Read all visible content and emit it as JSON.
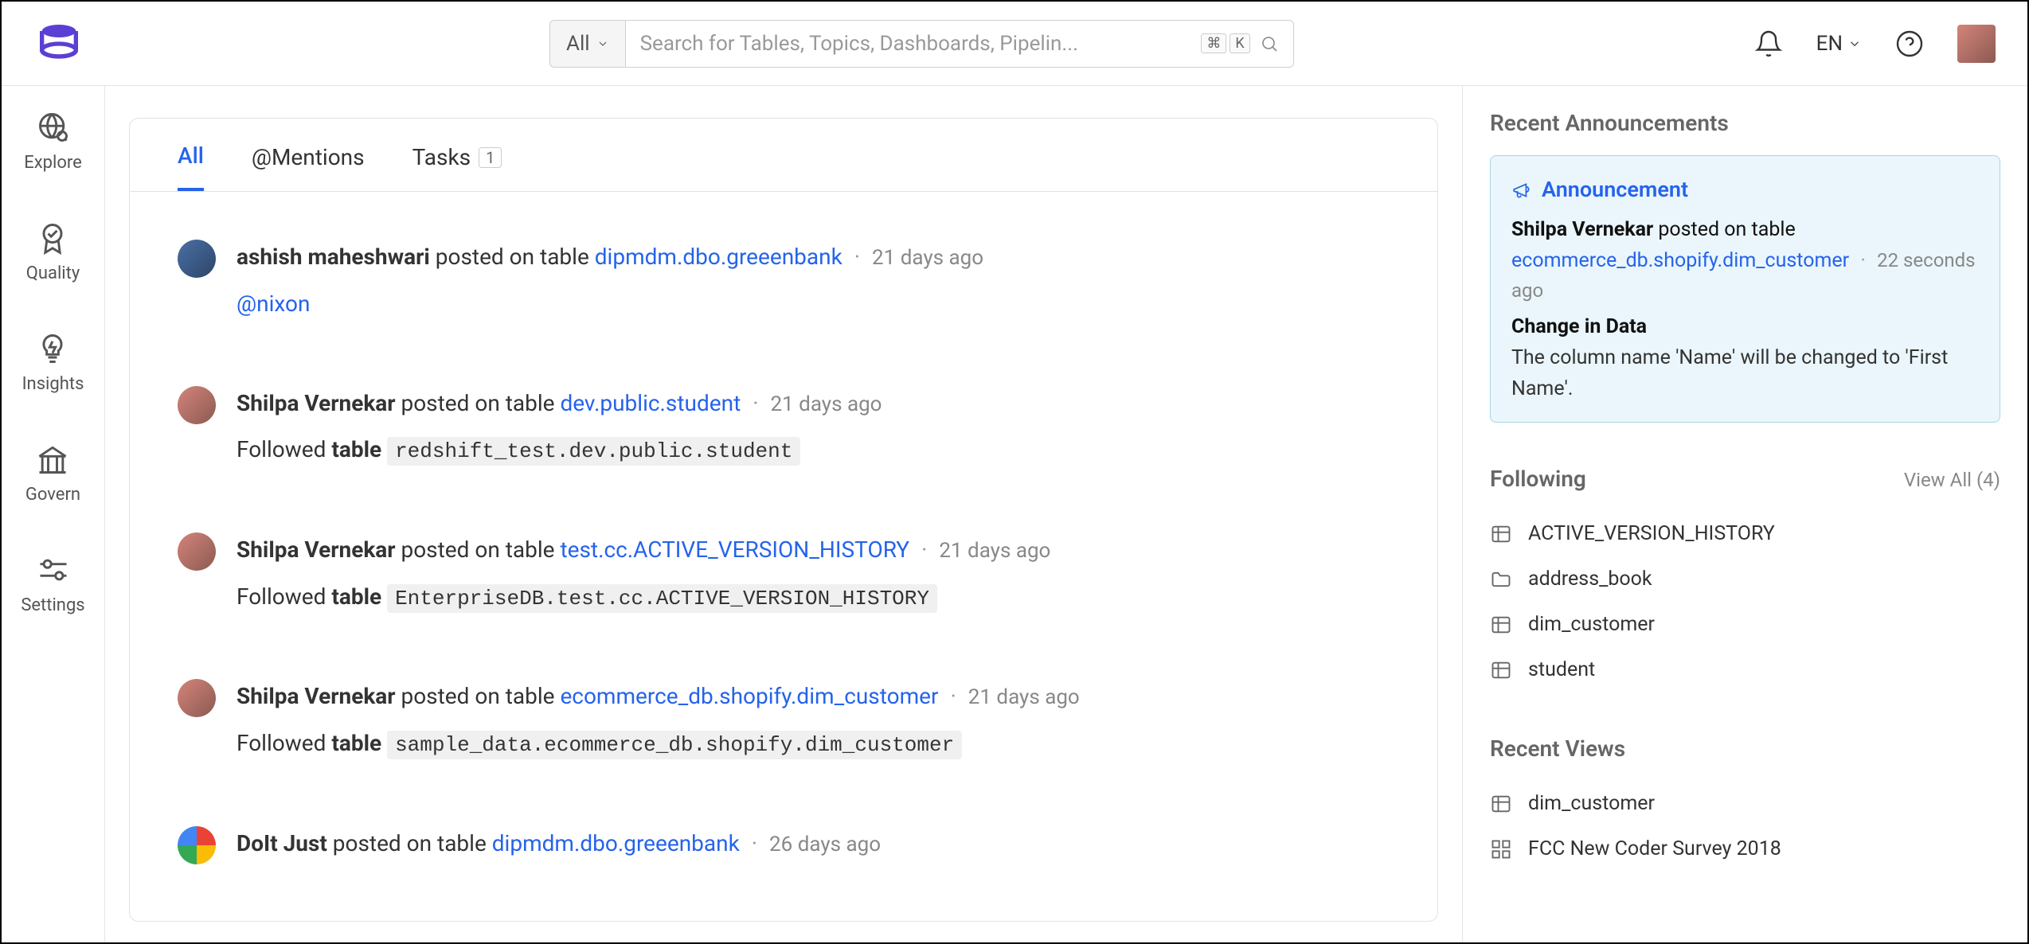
{
  "header": {
    "filter_label": "All",
    "search_placeholder": "Search for Tables, Topics, Dashboards, Pipelin...",
    "kbd1": "⌘",
    "kbd2": "K",
    "language": "EN"
  },
  "sidebar": {
    "items": [
      {
        "label": "Explore"
      },
      {
        "label": "Quality"
      },
      {
        "label": "Insights"
      },
      {
        "label": "Govern"
      },
      {
        "label": "Settings"
      }
    ]
  },
  "tabs": {
    "all": "All",
    "mentions": "@Mentions",
    "tasks": "Tasks",
    "tasks_count": "1"
  },
  "feed": [
    {
      "avatar": "blue",
      "user": "ashish maheshwari",
      "action": "posted on table",
      "target": "dipmdm.dbo.greeenbank",
      "time": "21 days ago",
      "body_type": "mention",
      "mention": "@nixon"
    },
    {
      "avatar": "brown",
      "user": "Shilpa Vernekar",
      "action": "posted on table",
      "target": "dev.public.student",
      "time": "21 days ago",
      "body_type": "followed",
      "followed_prefix": "Followed ",
      "followed_bold": "table",
      "code": "redshift_test.dev.public.student"
    },
    {
      "avatar": "brown",
      "user": "Shilpa Vernekar",
      "action": "posted on table",
      "target": "test.cc.ACTIVE_VERSION_HISTORY",
      "time": "21 days ago",
      "body_type": "followed",
      "followed_prefix": "Followed ",
      "followed_bold": "table",
      "code": "EnterpriseDB.test.cc.ACTIVE_VERSION_HISTORY"
    },
    {
      "avatar": "brown",
      "user": "Shilpa Vernekar",
      "action": "posted on table",
      "target": "ecommerce_db.shopify.dim_customer",
      "time": "21 days ago",
      "body_type": "followed",
      "followed_prefix": "Followed ",
      "followed_bold": "table",
      "code": "sample_data.ecommerce_db.shopify.dim_customer"
    },
    {
      "avatar": "google",
      "user": "DoIt Just",
      "action": "posted on table",
      "target": "dipmdm.dbo.greeenbank",
      "time": "26 days ago",
      "body_type": "none"
    }
  ],
  "right": {
    "announcements_title": "Recent Announcements",
    "announcement": {
      "header": "Announcement",
      "user": "Shilpa Vernekar",
      "action": "posted on table",
      "target": "ecommerce_db.shopify.dim_customer",
      "time": "22 seconds ago",
      "title": "Change in Data",
      "body": "The column name 'Name' will be changed to 'First Name'."
    },
    "following_title": "Following",
    "following_viewall": "View All (4)",
    "following_items": [
      {
        "icon": "table",
        "label": "ACTIVE_VERSION_HISTORY"
      },
      {
        "icon": "folder",
        "label": "address_book"
      },
      {
        "icon": "table",
        "label": "dim_customer"
      },
      {
        "icon": "table",
        "label": "student"
      }
    ],
    "recent_title": "Recent Views",
    "recent_items": [
      {
        "icon": "table",
        "label": "dim_customer"
      },
      {
        "icon": "dashboard",
        "label": "FCC New Coder Survey 2018"
      }
    ]
  }
}
